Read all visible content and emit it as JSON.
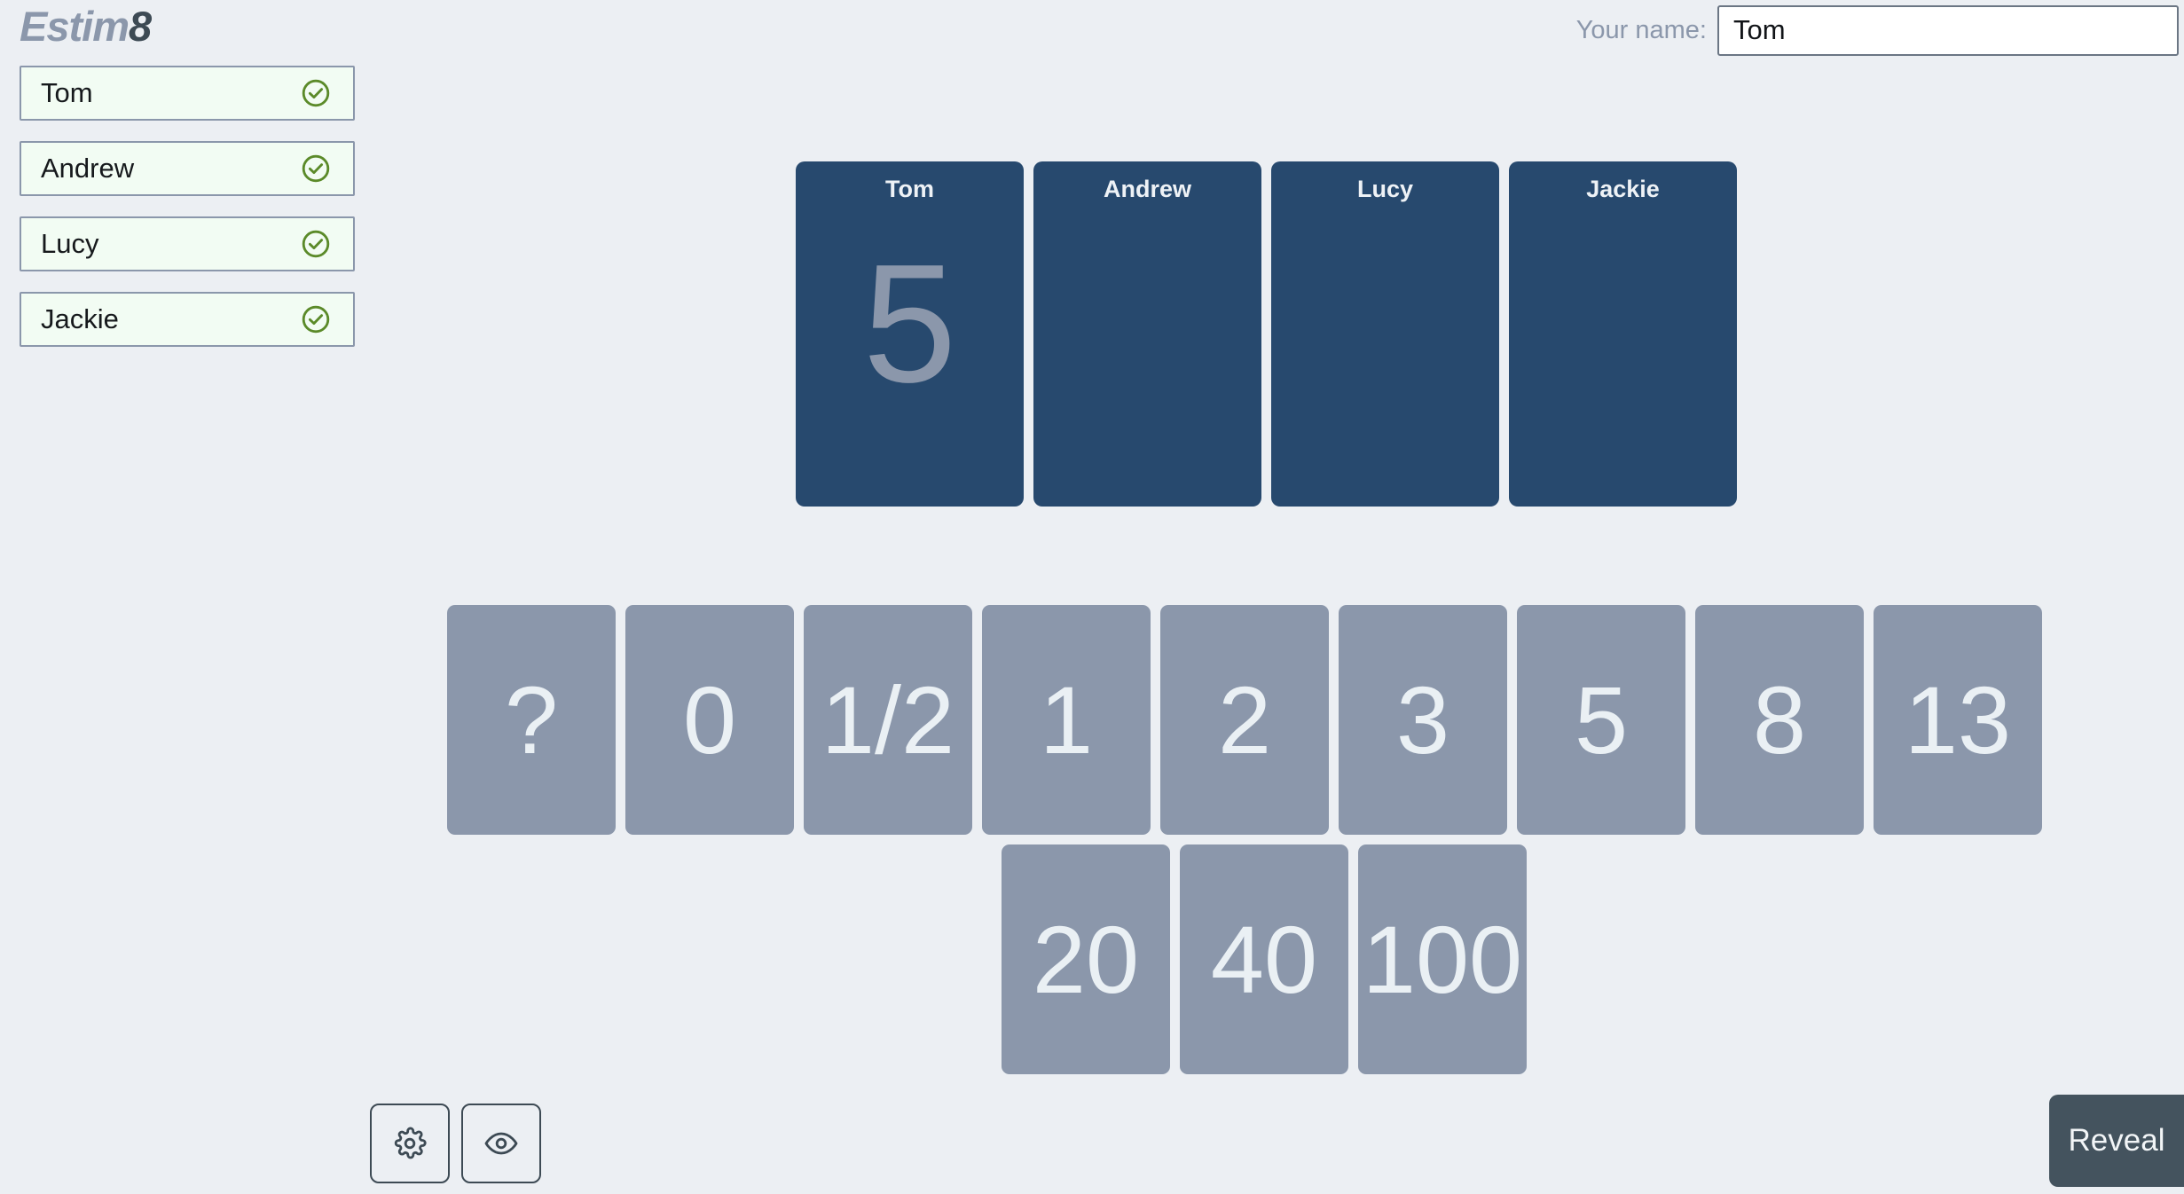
{
  "app": {
    "logo_main": "Estim",
    "logo_accent": "8"
  },
  "header": {
    "name_label": "Your name:",
    "name_value": "Tom",
    "name_placeholder": "Your name"
  },
  "players": [
    {
      "name": "Tom",
      "status_icon": "check-circle-icon",
      "voted": true
    },
    {
      "name": "Andrew",
      "status_icon": "check-circle-icon",
      "voted": true
    },
    {
      "name": "Lucy",
      "status_icon": "check-circle-icon",
      "voted": true
    },
    {
      "name": "Jackie",
      "status_icon": "check-circle-icon",
      "voted": true
    }
  ],
  "vote_cards": [
    {
      "name": "Tom",
      "value": "5"
    },
    {
      "name": "Andrew",
      "value": ""
    },
    {
      "name": "Lucy",
      "value": ""
    },
    {
      "name": "Jackie",
      "value": ""
    }
  ],
  "deck": {
    "row1": [
      "?",
      "0",
      "1/2",
      "1",
      "2",
      "3",
      "5",
      "8",
      "13"
    ],
    "row2": [
      "20",
      "40",
      "100"
    ]
  },
  "footer": {
    "settings_icon": "gear-icon",
    "spectator_icon": "eye-icon",
    "reveal_label": "Reveal"
  },
  "colors": {
    "background": "#eceff3",
    "vote_card": "#27496e",
    "deck_card": "#8b97ab",
    "accent_gray": "#8b97ab",
    "dark_slate": "#3d4a54",
    "check_green": "#5b8a29",
    "player_row_bg": "#f2fcf3",
    "reveal_bg": "#44535e"
  }
}
